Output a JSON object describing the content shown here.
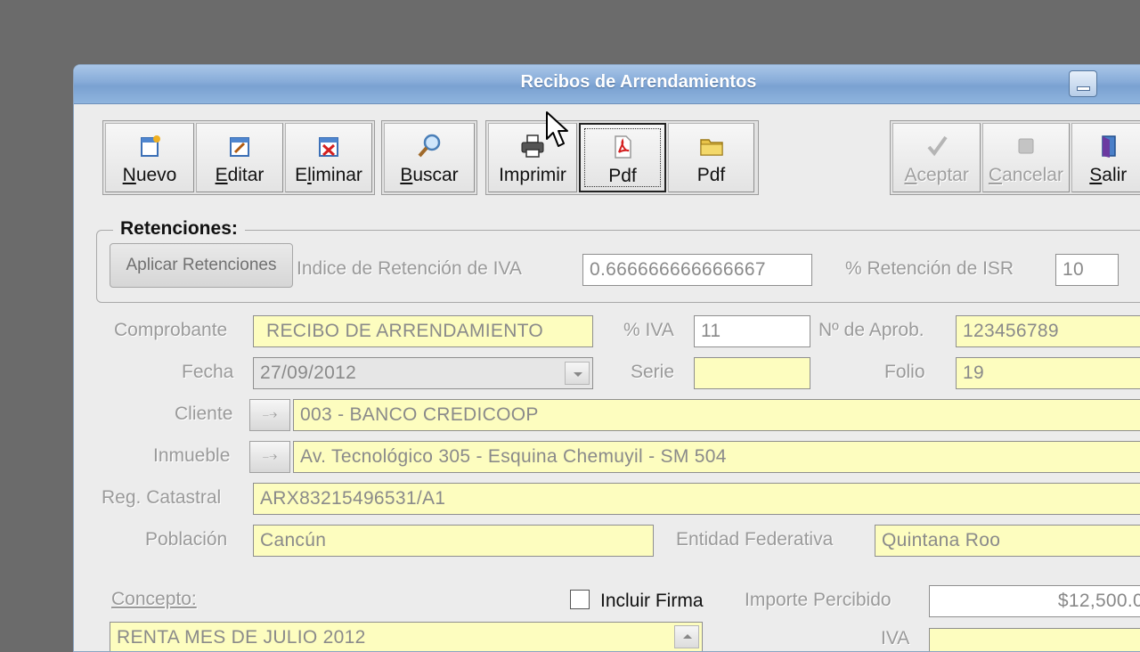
{
  "window": {
    "title": "Recibos de Arrendamientos"
  },
  "toolbar": {
    "nuevo": {
      "mnemonic": "N",
      "rest": "uevo"
    },
    "editar": {
      "mnemonic": "E",
      "rest": "ditar"
    },
    "eliminar": {
      "pre": "E",
      "mnemonic": "l",
      "rest": "iminar"
    },
    "buscar": {
      "mnemonic": "B",
      "rest": "uscar"
    },
    "imprimir": "Imprimir",
    "pdf_label": "Pdf",
    "pdf_folder_label": "Pdf",
    "aceptar": {
      "mnemonic": "A",
      "rest": "ceptar"
    },
    "cancelar": {
      "mnemonic": "C",
      "rest": "ancelar"
    },
    "salir": {
      "mnemonic": "S",
      "rest": "alir"
    }
  },
  "retenciones": {
    "legend": "Retenciones:",
    "apply_button": "Aplicar Retenciones",
    "iva_index_label": "Indice de Retención de IVA",
    "iva_index_value": "0.666666666666667",
    "isr_label": "% Retención de ISR",
    "isr_value": "10"
  },
  "form": {
    "comprobante_label": "Comprobante",
    "comprobante_value": "RECIBO DE ARRENDAMIENTO",
    "iva_label": "% IVA",
    "iva_value": "11",
    "aprob_label": "Nº de Aprob.",
    "aprob_value": "123456789",
    "fecha_label": "Fecha",
    "fecha_value": "27/09/2012",
    "serie_label": "Serie",
    "serie_value": "",
    "folio_label": "Folio",
    "folio_value": "19",
    "cliente_label": "Cliente",
    "cliente_value": "003 - BANCO CREDICOOP",
    "inmueble_label": "Inmueble",
    "inmueble_value": "Av. Tecnológico 305 - Esquina Chemuyil - SM 504",
    "catastral_label": "Reg. Catastral",
    "catastral_value": "ARX83215496531/A1",
    "poblacion_label": "Población",
    "poblacion_value": "Cancún",
    "entidad_label": "Entidad Federativa",
    "entidad_value": "Quintana Roo",
    "concepto_label": "Concepto:",
    "incluir_firma_label": "Incluir Firma",
    "importe_label": "Importe Percibido",
    "importe_value": "$12,500.0",
    "concepto_value": "RENTA MES DE JULIO 2012",
    "iva_bottom_label": "IVA"
  },
  "colors": {
    "field_yellow": "#fdfdbf",
    "title_blue": "#86abd8"
  }
}
